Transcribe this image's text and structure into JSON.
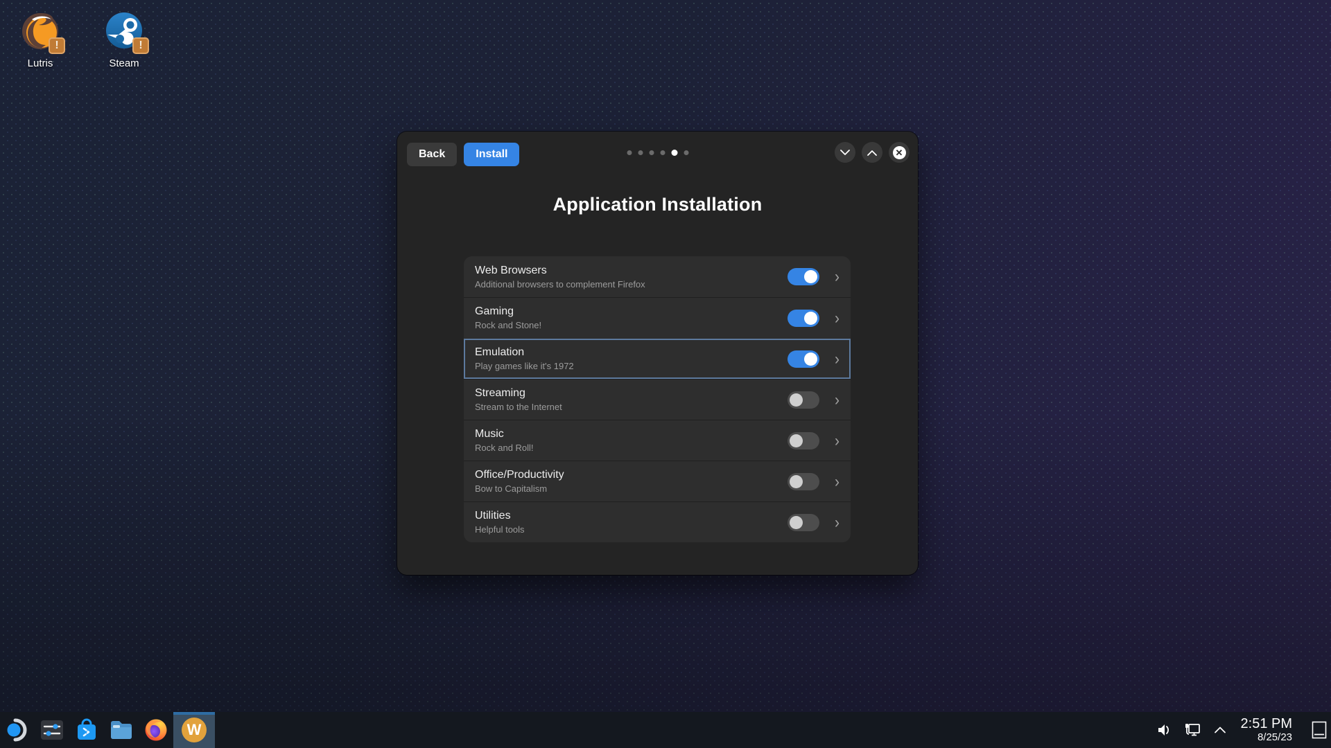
{
  "desktop": {
    "icons": [
      {
        "label": "Lutris",
        "badge": "!"
      },
      {
        "label": "Steam",
        "badge": "!"
      }
    ]
  },
  "dialog": {
    "toolbar": {
      "back_label": "Back",
      "install_label": "Install"
    },
    "carousel": {
      "total": 6,
      "active_index": 4
    },
    "title": "Application Installation",
    "rows": [
      {
        "title": "Web Browsers",
        "subtitle": "Additional browsers to complement Firefox",
        "enabled": true,
        "highlighted": false
      },
      {
        "title": "Gaming",
        "subtitle": "Rock and Stone!",
        "enabled": true,
        "highlighted": false
      },
      {
        "title": "Emulation",
        "subtitle": "Play games like it's 1972",
        "enabled": true,
        "highlighted": true
      },
      {
        "title": "Streaming",
        "subtitle": "Stream to the Internet",
        "enabled": false,
        "highlighted": false
      },
      {
        "title": "Music",
        "subtitle": "Rock and Roll!",
        "enabled": false,
        "highlighted": false
      },
      {
        "title": "Office/Productivity",
        "subtitle": "Bow to Capitalism",
        "enabled": false,
        "highlighted": false
      },
      {
        "title": "Utilities",
        "subtitle": "Helpful tools",
        "enabled": false,
        "highlighted": false
      }
    ]
  },
  "taskbar": {
    "clock": {
      "time": "2:51 PM",
      "date": "8/25/23"
    }
  },
  "colors": {
    "accent": "#3584e4",
    "toggle_off": "#4d4d4d",
    "focus_ring": "#5d7a9e",
    "active_task_bg": "#3a4f63"
  }
}
